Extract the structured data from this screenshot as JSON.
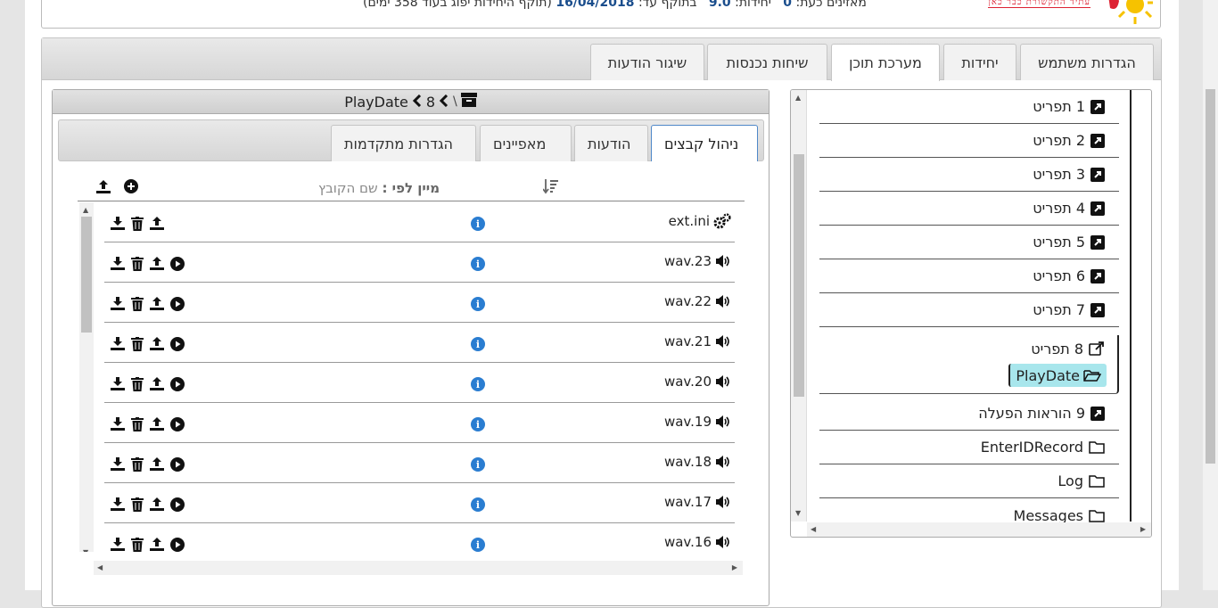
{
  "topbar": {
    "slogan": "עתיד התקשורת כבר כאן",
    "status_prefix": "מאזינים כעת:",
    "listeners": "0",
    "units_label": "יחידות:",
    "units": "9.0",
    "valid_label": "בתוקף עד:",
    "valid_until": "16/04/2018",
    "expiry_note": "(תוקף היחידות יפוג בעוד 358 ימים)"
  },
  "main_tabs": [
    {
      "label": "הגדרות משתמש"
    },
    {
      "label": "יחידות"
    },
    {
      "label": "מערכת תוכן"
    },
    {
      "label": "שיחות נכנסות"
    },
    {
      "label": "שיגור הודעות"
    }
  ],
  "tree": {
    "items": [
      {
        "label": "1 תפריט"
      },
      {
        "label": "2 תפריט"
      },
      {
        "label": "3 תפריט"
      },
      {
        "label": "4 תפריט"
      },
      {
        "label": "5 תפריט"
      },
      {
        "label": "6 תפריט"
      },
      {
        "label": "7 תפריט"
      },
      {
        "label": "8 תפריט"
      },
      {
        "label": "PlayDate"
      },
      {
        "label": "9 הוראות הפעלה"
      },
      {
        "label": "EnterIDRecord"
      },
      {
        "label": "Log"
      },
      {
        "label": "Messages"
      }
    ]
  },
  "files_panel": {
    "path_root": "\\",
    "path_folder": "8",
    "path_current": "PlayDate",
    "tabs": [
      {
        "label": "ניהול קבצים"
      },
      {
        "label": "הודעות"
      },
      {
        "label": "מאפיינים"
      },
      {
        "label": "הגדרות מתקדמות"
      }
    ],
    "sort_label": "מיין לפי :",
    "sort_value": "שם הקובץ",
    "files": [
      {
        "name": "ext.ini",
        "type": "config"
      },
      {
        "name": "wav.23",
        "type": "audio"
      },
      {
        "name": "wav.22",
        "type": "audio"
      },
      {
        "name": "wav.21",
        "type": "audio"
      },
      {
        "name": "wav.20",
        "type": "audio"
      },
      {
        "name": "wav.19",
        "type": "audio"
      },
      {
        "name": "wav.18",
        "type": "audio"
      },
      {
        "name": "wav.17",
        "type": "audio"
      },
      {
        "name": "wav.16",
        "type": "audio"
      }
    ]
  },
  "colors": {
    "accent_tab_border": "#4f88c9",
    "selected_node": "#a8e6ec",
    "info_icon": "#2a7dd1",
    "status_value": "#1a4d8c"
  }
}
